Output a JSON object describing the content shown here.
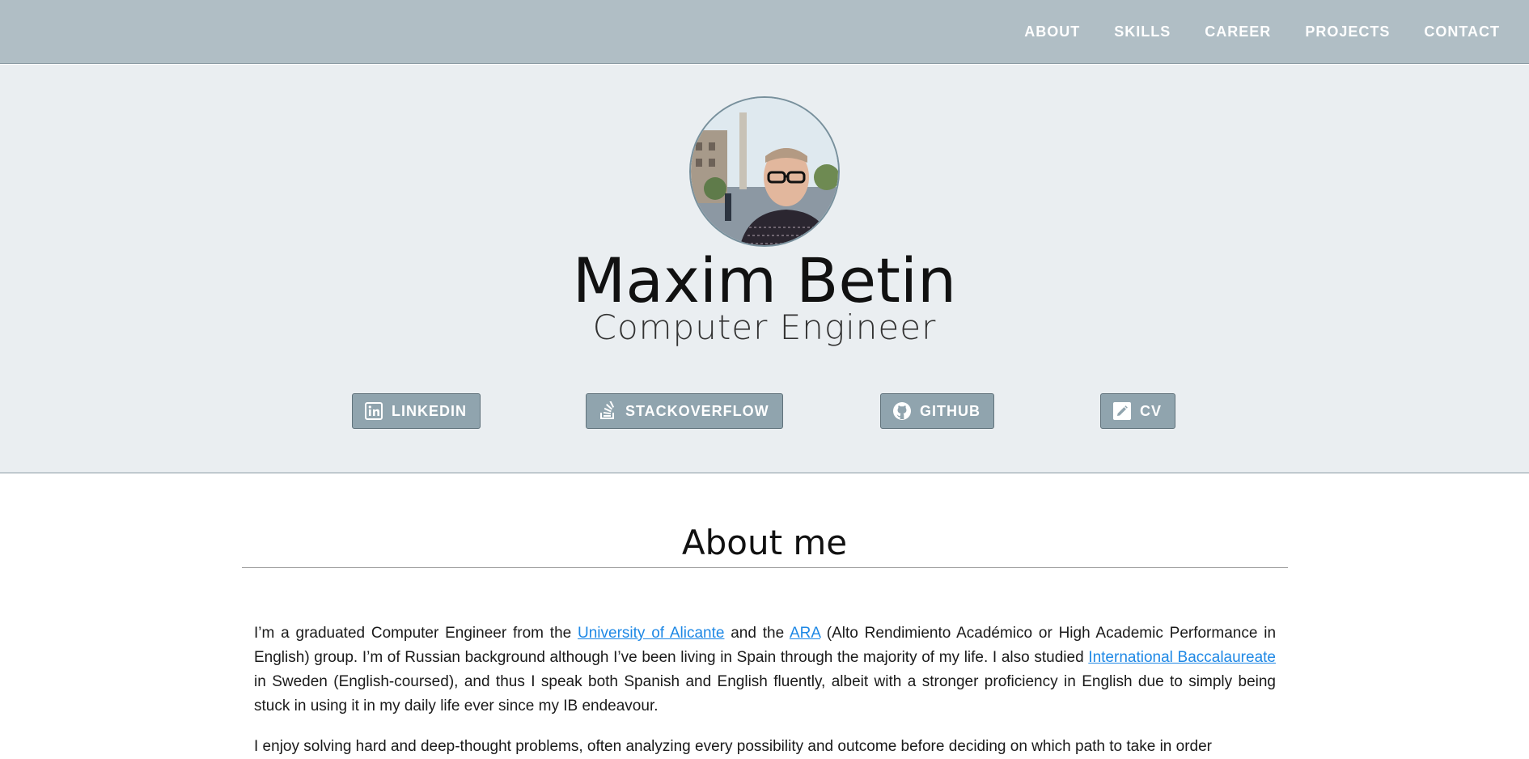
{
  "nav": {
    "items": [
      "ABOUT",
      "SKILLS",
      "CAREER",
      "PROJECTS",
      "CONTACT"
    ]
  },
  "hero": {
    "name": "Maxim Betin",
    "role": "Computer Engineer",
    "buttons": [
      {
        "label": "LINKEDIN",
        "icon": "linkedin-icon"
      },
      {
        "label": "STACKOVERFLOW",
        "icon": "stackoverflow-icon"
      },
      {
        "label": "GITHUB",
        "icon": "github-icon"
      },
      {
        "label": "CV",
        "icon": "edit-icon"
      }
    ]
  },
  "about": {
    "title": "About me",
    "p1": {
      "t1": "I’m a graduated Computer Engineer from the ",
      "link1": "University of Alicante",
      "t2": " and the ",
      "link2": "ARA",
      "t3": " (Alto Rendimiento Académico or High Academic Performance in English) group. I’m of Russian background although I’ve been living in Spain through the majority of my life. I also studied ",
      "link3": "International Baccalaureate",
      "t4": " in Sweden (English-coursed), and thus I speak both Spanish and English fluently, albeit with a stronger proficiency in English due to simply being stuck in using it in my daily life ever since my IB endeavour."
    },
    "p2": "I enjoy solving hard and deep-thought problems, often analyzing every possibility and outcome before deciding on which path to take in order"
  },
  "colors": {
    "navbar": "#b0bec5",
    "hero_bg": "#eaeef1",
    "button": "#90a4ae",
    "link": "#1e88e5"
  }
}
